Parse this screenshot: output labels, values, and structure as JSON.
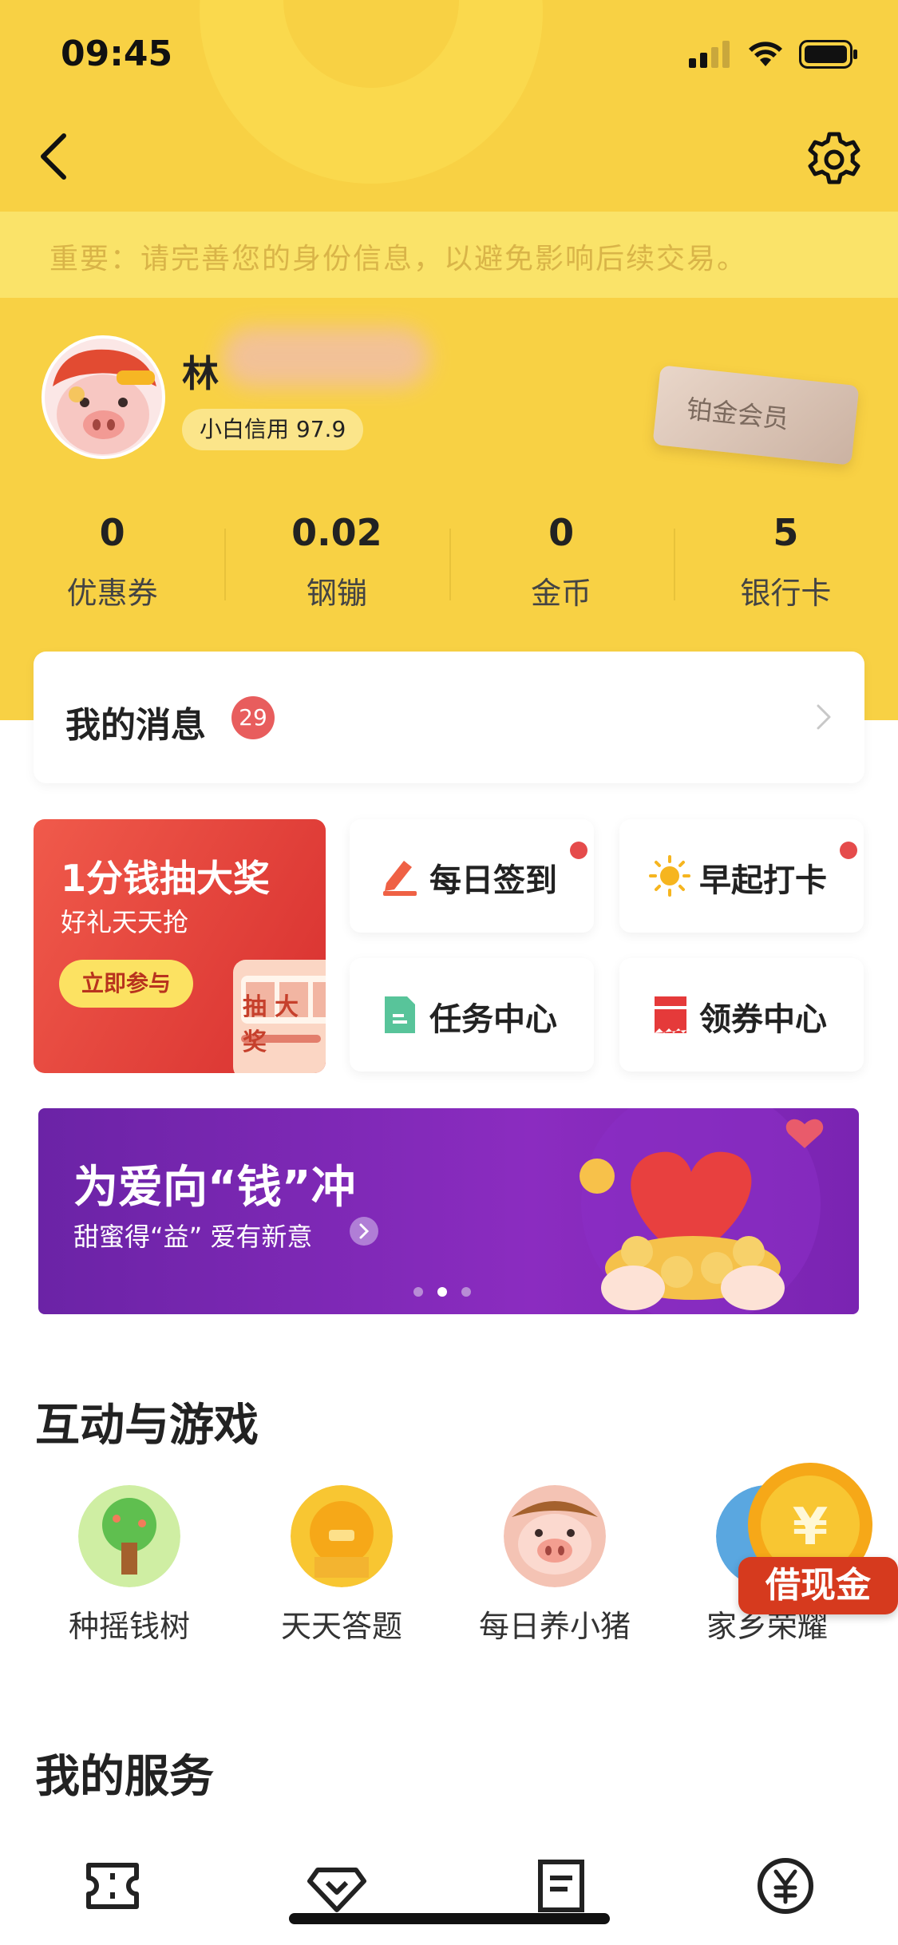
{
  "status_bar": {
    "time": "09:45",
    "battery_icon": "battery-full-icon",
    "wifi_icon": "wifi-icon",
    "signal_icon": "signal-bars-icon"
  },
  "nav": {
    "back_icon": "chevron-left-icon",
    "settings_icon": "gear-icon"
  },
  "notice": {
    "text": "重要：请完善您的身份信息，以避免影响后续交易。"
  },
  "profile": {
    "name": "林",
    "credit_label": "小白信用",
    "credit_score": "97.9",
    "member_card": "铂金会员",
    "stats": [
      {
        "value": "0",
        "label": "优惠券"
      },
      {
        "value": "0.02",
        "label": "钢镚"
      },
      {
        "value": "0",
        "label": "金币"
      },
      {
        "value": "5",
        "label": "银行卡"
      }
    ]
  },
  "messages": {
    "title": "我的消息",
    "badge": "29"
  },
  "lottery": {
    "title": "1分钱抽大奖",
    "subtitle": "好礼天天抢",
    "button": "立即参与",
    "machine_text": "抽大奖"
  },
  "tiles": [
    {
      "label": "每日签到",
      "icon": "pencil-icon",
      "dot": true
    },
    {
      "label": "早起打卡",
      "icon": "sun-icon",
      "dot": true
    },
    {
      "label": "任务中心",
      "icon": "document-icon",
      "dot": false
    },
    {
      "label": "领券中心",
      "icon": "coupon-icon",
      "dot": false
    }
  ],
  "banner": {
    "title": "为爱向“钱”冲",
    "subtitle": "甜蜜得“益” 爱有新意",
    "pages": 3,
    "active_page": 2
  },
  "games_section": {
    "title": "互动与游戏",
    "items": [
      {
        "label": "种摇钱树",
        "icon": "money-tree-icon"
      },
      {
        "label": "天天答题",
        "icon": "gold-coin-icon"
      },
      {
        "label": "每日养小猪",
        "icon": "pig-icon"
      },
      {
        "label": "家乡荣耀",
        "icon": "hometown-icon"
      }
    ]
  },
  "loan_float": {
    "label": "借现金",
    "icon": "yen-coin-icon"
  },
  "services_section": {
    "title": "我的服务",
    "items": [
      {
        "icon": "ticket-icon"
      },
      {
        "icon": "diamond-icon"
      },
      {
        "icon": "bill-icon"
      },
      {
        "icon": "yen-circle-icon"
      }
    ]
  },
  "colors": {
    "brand_yellow": "#f8d144",
    "notice_yellow": "#fae369",
    "badge_red": "#e85d5d",
    "banner_purple": "#7a24b2"
  }
}
